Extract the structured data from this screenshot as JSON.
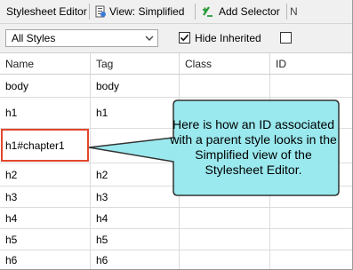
{
  "toolbar": {
    "title": "Stylesheet Editor",
    "view_label": "View: Simplified",
    "add_selector_label": "Add Selector",
    "overflow_label": "N"
  },
  "filters": {
    "style_filter": "All Styles",
    "hide_inherited_label": "Hide Inherited",
    "hide_inherited_checked": true
  },
  "table": {
    "columns": [
      "Name",
      "Tag",
      "Class",
      "ID"
    ],
    "rows": [
      {
        "name": "body",
        "tag": "body",
        "class": "",
        "id": ""
      },
      {
        "name": "h1",
        "tag": "h1",
        "class": "",
        "id": ""
      },
      {
        "name": "h1#chapter1",
        "tag": "",
        "class": "",
        "id": ""
      },
      {
        "name": "h2",
        "tag": "h2",
        "class": "",
        "id": ""
      },
      {
        "name": "h3",
        "tag": "h3",
        "class": "",
        "id": ""
      },
      {
        "name": "h4",
        "tag": "h4",
        "class": "",
        "id": ""
      },
      {
        "name": "h5",
        "tag": "h5",
        "class": "",
        "id": ""
      },
      {
        "name": "h6",
        "tag": "h6",
        "class": "",
        "id": ""
      }
    ]
  },
  "callout": {
    "text": "Here is how an ID associated with a parent style looks in the Simplified view of the Stylesheet Editor.",
    "fill_color": "#9ae9ee",
    "border_color": "#333333"
  },
  "highlight": {
    "border_color": "#e2462a"
  }
}
